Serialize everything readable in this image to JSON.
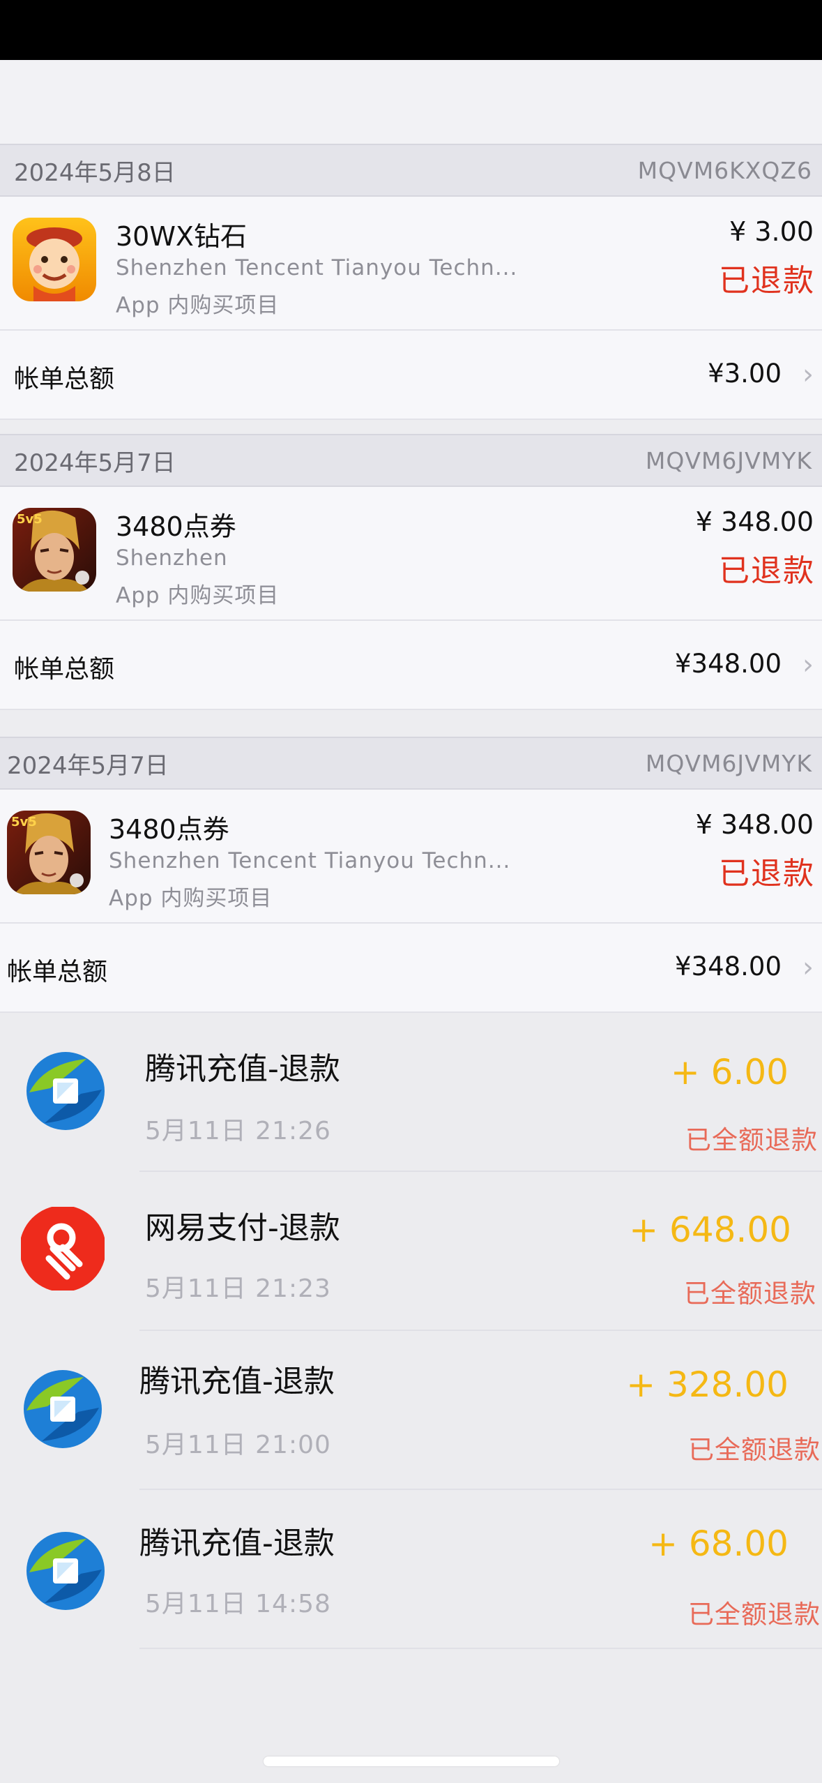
{
  "receipts": [
    {
      "date": "2024年5月8日",
      "order_id": "MQVM6KXQZ6",
      "item_title": "30WX钻石",
      "seller": "Shenzhen Tencent Tianyou Techn...",
      "item_type": "App 内购买项目",
      "price": "¥ 3.00",
      "status": "已退款",
      "total_label": "帐单总额",
      "total_value": "¥3.00",
      "icon": "cartoon-game-app-icon"
    },
    {
      "date": "2024年5月7日",
      "order_id": "MQVM6JVMYK",
      "item_title": "3480点券",
      "seller": "Shenzhen",
      "item_type": "App 内购买项目",
      "price": "¥ 348.00",
      "status": "已退款",
      "total_label": "帐单总额",
      "total_value": "¥348.00",
      "icon": "honor-of-kings-app-icon"
    },
    {
      "date": "2024年5月7日",
      "order_id": "MQVM6JVMYK",
      "item_title": "3480点券",
      "seller": "Shenzhen Tencent Tianyou Techn...",
      "item_type": "App 内购买项目",
      "price": "¥ 348.00",
      "status": "已退款",
      "total_label": "帐单总额",
      "total_value": "¥348.00",
      "icon": "honor-of-kings-app-icon"
    }
  ],
  "refunds": [
    {
      "title": "腾讯充值-退款",
      "time": "5月11日 21:26",
      "amount": "+ 6.00",
      "status": "已全额退款",
      "icon": "tencent-recharge-icon"
    },
    {
      "title": "网易支付-退款",
      "time": "5月11日 21:23",
      "amount": "+ 648.00",
      "status": "已全额退款",
      "icon": "netease-pay-icon"
    },
    {
      "title": "腾讯充值-退款",
      "time": "5月11日 21:00",
      "amount": "+ 328.00",
      "status": "已全额退款",
      "icon": "tencent-recharge-icon"
    },
    {
      "title": "腾讯充值-退款",
      "time": "5月11日 14:58",
      "amount": "+ 68.00",
      "status": "已全额退款",
      "icon": "tencent-recharge-icon"
    }
  ],
  "colors": {
    "refund_red": "#e0321e",
    "amount_yellow": "#f5b814",
    "status_orange": "#e86a58"
  }
}
